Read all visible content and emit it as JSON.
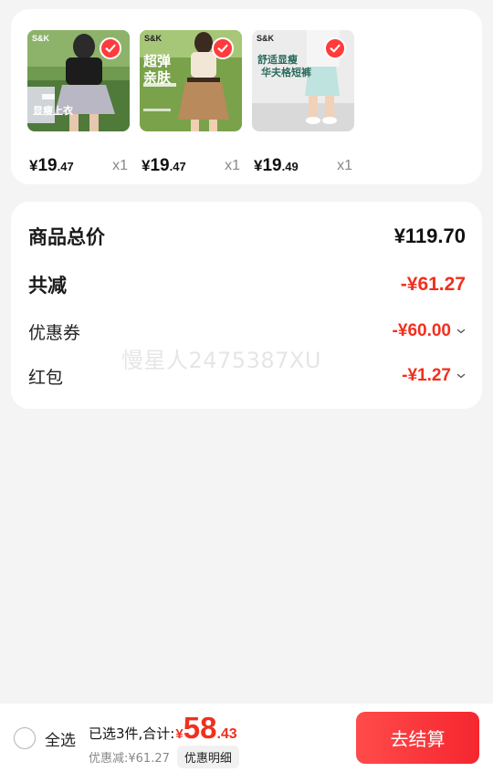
{
  "products": [
    {
      "brand": "S&K",
      "overlay_text": [
        "显瘦上衣"
      ],
      "price_yen": "¥",
      "price_int": "19",
      "price_dec": ".47",
      "quantity": "x1",
      "selected": true
    },
    {
      "brand": "S&K",
      "overlay_text": [
        "超弹",
        "亲肤"
      ],
      "price_yen": "¥",
      "price_int": "19",
      "price_dec": ".47",
      "quantity": "x1",
      "selected": true
    },
    {
      "brand": "S&K",
      "overlay_text": [
        "舒适显瘦",
        "华夫格短裤"
      ],
      "price_yen": "¥",
      "price_int": "19",
      "price_dec": ".49",
      "quantity": "x1",
      "selected": true
    }
  ],
  "summary": {
    "total_label": "商品总价",
    "total_value": "¥119.70",
    "reduction_label": "共减",
    "reduction_value": "-¥61.27",
    "coupon_label": "优惠券",
    "coupon_value": "-¥60.00",
    "redpacket_label": "红包",
    "redpacket_value": "-¥1.27"
  },
  "watermark": "慢星人2475387XU",
  "bottom_bar": {
    "select_all_label": "全选",
    "selected_total_label": "已选3件,合计:",
    "total_yen": "¥",
    "total_int": "58",
    "total_dec": ".43",
    "discount_text": "优惠减:¥61.27",
    "detail_button_label": "优惠明细",
    "checkout_button_label": "去结算"
  },
  "colors": {
    "accent_red": "#f0301e",
    "check_red": "#ff3b3b",
    "background": "#f4f4f4"
  },
  "icons": [
    "check-circle-icon",
    "chevron-down-icon",
    "radio-unchecked-icon"
  ]
}
